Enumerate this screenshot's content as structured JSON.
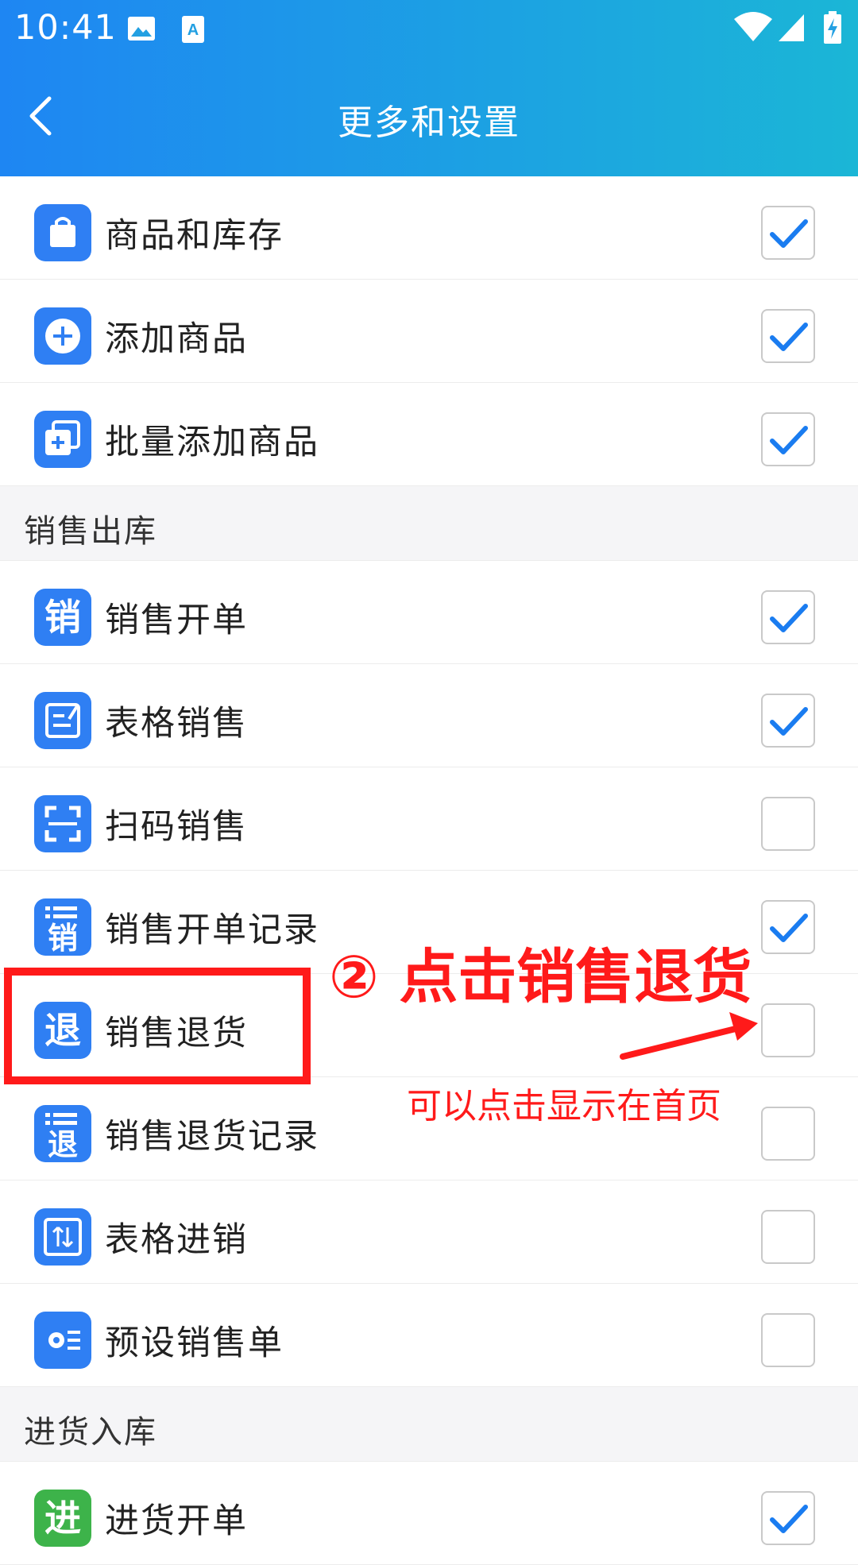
{
  "status": {
    "time": "10:41"
  },
  "header": {
    "title": "更多和设置"
  },
  "groups": [
    {
      "label": "",
      "items": [
        {
          "name": "商品和库存",
          "icon": "bag-icon",
          "checked": true
        },
        {
          "name": "添加商品",
          "icon": "plus-circle-icon",
          "checked": true
        },
        {
          "name": "批量添加商品",
          "icon": "batch-add-icon",
          "checked": true
        }
      ]
    },
    {
      "label": "销售出库",
      "items": [
        {
          "name": "销售开单",
          "icon": "sales-order-icon",
          "glyph": "销",
          "checked": true
        },
        {
          "name": "表格销售",
          "icon": "table-edit-icon",
          "checked": true
        },
        {
          "name": "扫码销售",
          "icon": "scan-icon",
          "checked": false
        },
        {
          "name": "销售开单记录",
          "icon": "sales-record-icon",
          "glyph": "销",
          "checked": true
        },
        {
          "name": "销售退货",
          "icon": "sales-return-icon",
          "glyph": "退",
          "checked": false
        },
        {
          "name": "销售退货记录",
          "icon": "return-record-icon",
          "glyph": "退",
          "checked": false
        },
        {
          "name": "表格进销",
          "icon": "exchange-icon",
          "checked": false
        },
        {
          "name": "预设销售单",
          "icon": "preset-settings-icon",
          "checked": false
        }
      ]
    },
    {
      "label": "进货入库",
      "items": [
        {
          "name": "进货开单",
          "icon": "purchase-order-icon",
          "glyph": "进",
          "checked": true
        }
      ]
    }
  ],
  "annotation": {
    "step": "② 点击销售退货",
    "hint": "可以点击显示在首页",
    "color": "#ff1a1a"
  },
  "colors": {
    "accent": "#2f7ff3",
    "check": "#1a7cf0"
  }
}
